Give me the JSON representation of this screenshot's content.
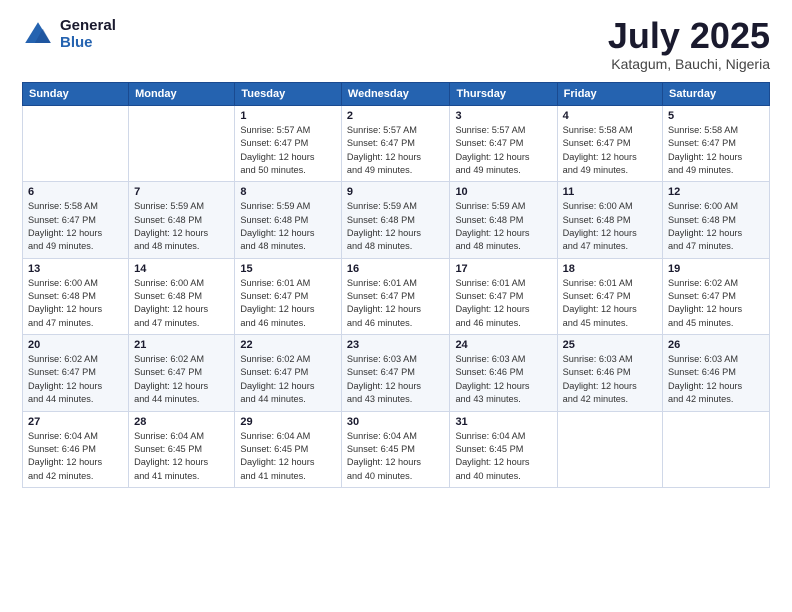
{
  "logo": {
    "general": "General",
    "blue": "Blue"
  },
  "title": "July 2025",
  "location": "Katagum, Bauchi, Nigeria",
  "days_header": [
    "Sunday",
    "Monday",
    "Tuesday",
    "Wednesday",
    "Thursday",
    "Friday",
    "Saturday"
  ],
  "weeks": [
    [
      {
        "num": "",
        "info": ""
      },
      {
        "num": "",
        "info": ""
      },
      {
        "num": "1",
        "info": "Sunrise: 5:57 AM\nSunset: 6:47 PM\nDaylight: 12 hours\nand 50 minutes."
      },
      {
        "num": "2",
        "info": "Sunrise: 5:57 AM\nSunset: 6:47 PM\nDaylight: 12 hours\nand 49 minutes."
      },
      {
        "num": "3",
        "info": "Sunrise: 5:57 AM\nSunset: 6:47 PM\nDaylight: 12 hours\nand 49 minutes."
      },
      {
        "num": "4",
        "info": "Sunrise: 5:58 AM\nSunset: 6:47 PM\nDaylight: 12 hours\nand 49 minutes."
      },
      {
        "num": "5",
        "info": "Sunrise: 5:58 AM\nSunset: 6:47 PM\nDaylight: 12 hours\nand 49 minutes."
      }
    ],
    [
      {
        "num": "6",
        "info": "Sunrise: 5:58 AM\nSunset: 6:47 PM\nDaylight: 12 hours\nand 49 minutes."
      },
      {
        "num": "7",
        "info": "Sunrise: 5:59 AM\nSunset: 6:48 PM\nDaylight: 12 hours\nand 48 minutes."
      },
      {
        "num": "8",
        "info": "Sunrise: 5:59 AM\nSunset: 6:48 PM\nDaylight: 12 hours\nand 48 minutes."
      },
      {
        "num": "9",
        "info": "Sunrise: 5:59 AM\nSunset: 6:48 PM\nDaylight: 12 hours\nand 48 minutes."
      },
      {
        "num": "10",
        "info": "Sunrise: 5:59 AM\nSunset: 6:48 PM\nDaylight: 12 hours\nand 48 minutes."
      },
      {
        "num": "11",
        "info": "Sunrise: 6:00 AM\nSunset: 6:48 PM\nDaylight: 12 hours\nand 47 minutes."
      },
      {
        "num": "12",
        "info": "Sunrise: 6:00 AM\nSunset: 6:48 PM\nDaylight: 12 hours\nand 47 minutes."
      }
    ],
    [
      {
        "num": "13",
        "info": "Sunrise: 6:00 AM\nSunset: 6:48 PM\nDaylight: 12 hours\nand 47 minutes."
      },
      {
        "num": "14",
        "info": "Sunrise: 6:00 AM\nSunset: 6:48 PM\nDaylight: 12 hours\nand 47 minutes."
      },
      {
        "num": "15",
        "info": "Sunrise: 6:01 AM\nSunset: 6:47 PM\nDaylight: 12 hours\nand 46 minutes."
      },
      {
        "num": "16",
        "info": "Sunrise: 6:01 AM\nSunset: 6:47 PM\nDaylight: 12 hours\nand 46 minutes."
      },
      {
        "num": "17",
        "info": "Sunrise: 6:01 AM\nSunset: 6:47 PM\nDaylight: 12 hours\nand 46 minutes."
      },
      {
        "num": "18",
        "info": "Sunrise: 6:01 AM\nSunset: 6:47 PM\nDaylight: 12 hours\nand 45 minutes."
      },
      {
        "num": "19",
        "info": "Sunrise: 6:02 AM\nSunset: 6:47 PM\nDaylight: 12 hours\nand 45 minutes."
      }
    ],
    [
      {
        "num": "20",
        "info": "Sunrise: 6:02 AM\nSunset: 6:47 PM\nDaylight: 12 hours\nand 44 minutes."
      },
      {
        "num": "21",
        "info": "Sunrise: 6:02 AM\nSunset: 6:47 PM\nDaylight: 12 hours\nand 44 minutes."
      },
      {
        "num": "22",
        "info": "Sunrise: 6:02 AM\nSunset: 6:47 PM\nDaylight: 12 hours\nand 44 minutes."
      },
      {
        "num": "23",
        "info": "Sunrise: 6:03 AM\nSunset: 6:47 PM\nDaylight: 12 hours\nand 43 minutes."
      },
      {
        "num": "24",
        "info": "Sunrise: 6:03 AM\nSunset: 6:46 PM\nDaylight: 12 hours\nand 43 minutes."
      },
      {
        "num": "25",
        "info": "Sunrise: 6:03 AM\nSunset: 6:46 PM\nDaylight: 12 hours\nand 42 minutes."
      },
      {
        "num": "26",
        "info": "Sunrise: 6:03 AM\nSunset: 6:46 PM\nDaylight: 12 hours\nand 42 minutes."
      }
    ],
    [
      {
        "num": "27",
        "info": "Sunrise: 6:04 AM\nSunset: 6:46 PM\nDaylight: 12 hours\nand 42 minutes."
      },
      {
        "num": "28",
        "info": "Sunrise: 6:04 AM\nSunset: 6:45 PM\nDaylight: 12 hours\nand 41 minutes."
      },
      {
        "num": "29",
        "info": "Sunrise: 6:04 AM\nSunset: 6:45 PM\nDaylight: 12 hours\nand 41 minutes."
      },
      {
        "num": "30",
        "info": "Sunrise: 6:04 AM\nSunset: 6:45 PM\nDaylight: 12 hours\nand 40 minutes."
      },
      {
        "num": "31",
        "info": "Sunrise: 6:04 AM\nSunset: 6:45 PM\nDaylight: 12 hours\nand 40 minutes."
      },
      {
        "num": "",
        "info": ""
      },
      {
        "num": "",
        "info": ""
      }
    ]
  ]
}
